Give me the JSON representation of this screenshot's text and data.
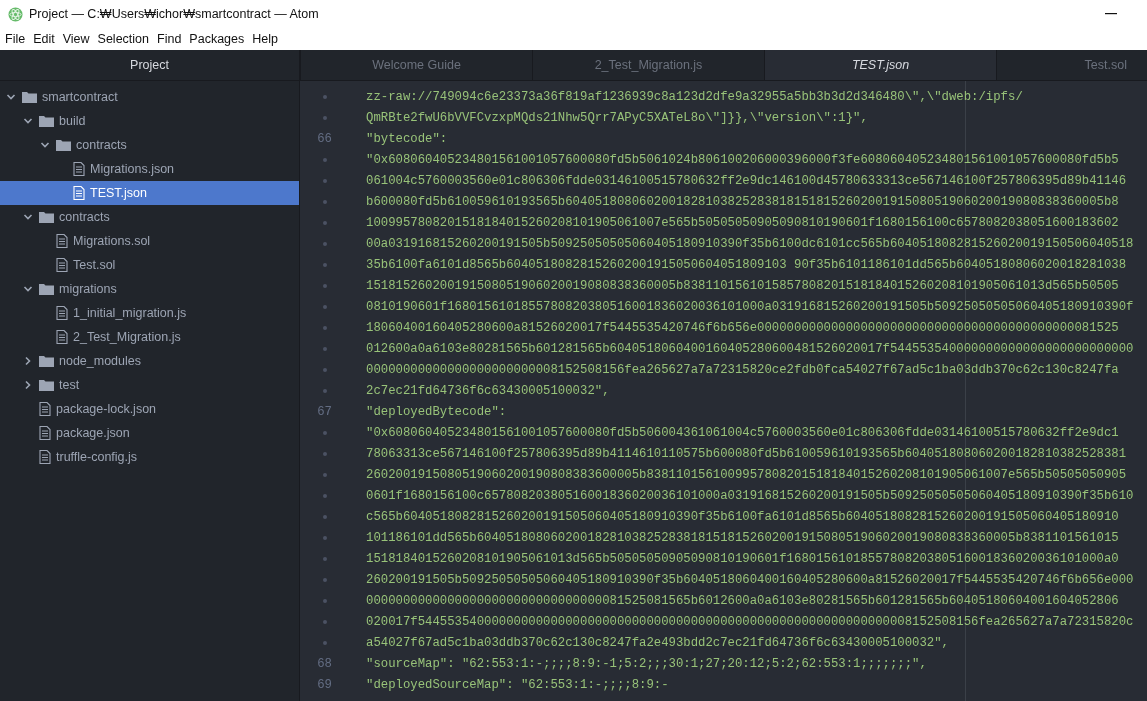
{
  "window": {
    "title": "Project — C:₩Users₩ichor₩smartcontract — Atom"
  },
  "menu": [
    "File",
    "Edit",
    "View",
    "Selection",
    "Find",
    "Packages",
    "Help"
  ],
  "sidebar": {
    "title": "Project",
    "tree": [
      {
        "name": "smartcontract",
        "kind": "folder",
        "expanded": true,
        "selected": false,
        "children": [
          {
            "name": "build",
            "kind": "folder",
            "expanded": true,
            "selected": false,
            "children": [
              {
                "name": "contracts",
                "kind": "folder",
                "expanded": true,
                "selected": false,
                "children": [
                  {
                    "name": "Migrations.json",
                    "kind": "file",
                    "selected": false
                  },
                  {
                    "name": "TEST.json",
                    "kind": "file",
                    "selected": true
                  }
                ]
              }
            ]
          },
          {
            "name": "contracts",
            "kind": "folder",
            "expanded": true,
            "selected": false,
            "children": [
              {
                "name": "Migrations.sol",
                "kind": "file",
                "selected": false
              },
              {
                "name": "Test.sol",
                "kind": "file",
                "selected": false
              }
            ]
          },
          {
            "name": "migrations",
            "kind": "folder",
            "expanded": true,
            "selected": false,
            "children": [
              {
                "name": "1_initial_migration.js",
                "kind": "file",
                "selected": false
              },
              {
                "name": "2_Test_Migration.js",
                "kind": "file",
                "selected": false
              }
            ]
          },
          {
            "name": "node_modules",
            "kind": "folder",
            "expanded": false,
            "selected": false
          },
          {
            "name": "test",
            "kind": "folder",
            "expanded": false,
            "selected": false
          },
          {
            "name": "package-lock.json",
            "kind": "file",
            "selected": false
          },
          {
            "name": "package.json",
            "kind": "file",
            "selected": false
          },
          {
            "name": "truffle-config.js",
            "kind": "file",
            "selected": false
          }
        ]
      }
    ]
  },
  "tabs": [
    {
      "label": "Welcome Guide",
      "selected": false
    },
    {
      "label": "2_Test_Migration.js",
      "selected": false
    },
    {
      "label": "TEST.json",
      "selected": true
    },
    {
      "label": "Test.sol",
      "selected": false
    }
  ],
  "editor": {
    "lines": [
      {
        "text": "zz-raw://749094c6e23373a36f819af1236939c8a123d2dfe9a32955a5bb3b3d2d346480\\\",\\\"dweb:/ipfs/"
      },
      {
        "text": "QmRBte2fwU6bVVFCvzxpMQds21Nhw5Qrr7APyC5XATeL8o\\\"]}},\\\"version\\\":1}\","
      },
      {
        "number": "66",
        "text": "\"bytecode\":"
      },
      {
        "text": "\"0x608060405234801561001057600080fd5b5061024b806100206000396000f3fe608060405234801561001057600080fd5b5"
      },
      {
        "text": "061004c5760003560e01c806306fdde03146100515780632ff2e9dc146100d45780633313ce567146100f257806395d89b41146"
      },
      {
        "text": "b600080fd5b610059610193565b6040518080602001828103825283818151815260200191508051906020019080838360005b8"
      },
      {
        "text": "1009957808201518184015260208101905061007e565b50505050905090810190601f1680156100c6578082038051600183602"
      },
      {
        "text": "00a031916815260200191505b50925050505060405180910390f35b6100dc6101cc565b604051808281526020019150506040518"
      },
      {
        "text": "35b6100fa6101d8565b60405180828152602001915050604051809103 90f35b6101186101dd565b60405180806020018281038"
      },
      {
        "text": "151815260200191508051906020019080838360005b8381101561015857808201518184015260208101905061013d565b50505"
      },
      {
        "text": "0810190601f1680156101855780820380516001836020036101000a031916815260200191505b50925050505060405180910390f"
      },
      {
        "text": "18060400160405280600a81526020017f5445535420746f6b656e0000000000000000000000000000000000000000000081525"
      },
      {
        "text": "012600a0a6103e80281565b601281565b6040518060400160405280600481526020017f544553540000000000000000000000000"
      },
      {
        "text": "00000000000000000000000008152508156fea265627a7a72315820ce2fdb0fca54027f67ad5c1ba03ddb370c62c130c8247fa"
      },
      {
        "text": "2c7ec21fd64736f6c63430005100032\","
      },
      {
        "number": "67",
        "text": "\"deployedBytecode\":"
      },
      {
        "text": "\"0x608060405234801561001057600080fd5b506004361061004c5760003560e01c806306fdde03146100515780632ff2e9dc1"
      },
      {
        "text": "78063313ce567146100f257806395d89b4114610110575b600080fd5b610059610193565b604051808060200182810382528381"
      },
      {
        "text": "2602001915080519060200190808383600005b8381101561009957808201518184015260208101905061007e565b50505050905"
      },
      {
        "text": "0601f1680156100c65780820380516001836020036101000a031916815260200191505b50925050505060405180910390f35b610"
      },
      {
        "text": "c565b6040518082815260200191505060405180910390f35b6100fa6101d8565b6040518082815260200191505060405180910"
      },
      {
        "text": "101186101dd565b6040518080602001828103825283818151815260200191508051906020019080838360005b8381101561015"
      },
      {
        "text": "1518184015260208101905061013d565b50505050905090810190601f1680156101855780820380516001836020036101000a0"
      },
      {
        "text": "260200191505b50925050505060405180910390f35b6040518060400160405280600a81526020017f5445535420746f6b656e000"
      },
      {
        "text": "00000000000000000000000000000000081525081565b6012600a0a6103e80281565b601281565b60405180604001604052806"
      },
      {
        "text": "020017f5445535400000000000000000000000000000000000000000000000000000000008152508156fea265627a7a72315820c"
      },
      {
        "text": "a54027f67ad5c1ba03ddb370c62c130c8247fa2e493bdd2c7ec21fd64736f6c63430005100032\","
      },
      {
        "number": "68",
        "text": "\"sourceMap\": \"62:553:1:-;;;;8:9:-1;5:2;;;30:1;27;20:12;5:2;62:553:1;;;;;;;\","
      },
      {
        "number": "69",
        "text": "\"deployedSourceMap\": \"62:553:1:-;;;;8:9:-"
      }
    ]
  }
}
